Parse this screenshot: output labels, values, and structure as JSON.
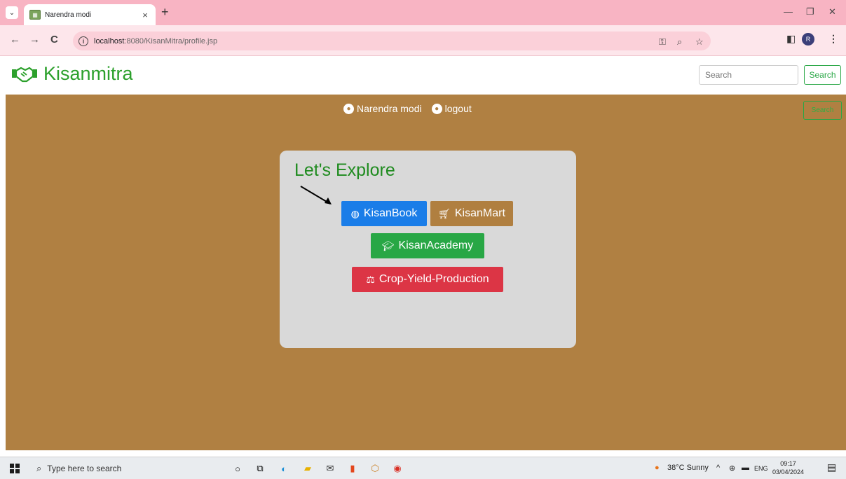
{
  "browser": {
    "tab_title": "Narendra modi",
    "tab_close": "×",
    "new_tab": "+",
    "url_host": "localhost",
    "url_rest": ":8080/KisanMitra/profile.jsp"
  },
  "header": {
    "brand": "Kisanmitra",
    "search_placeholder": "Search",
    "search_button": "Search"
  },
  "userbar": {
    "user_name": "Narendra modi",
    "logout": "logout",
    "ghost_search": "Search"
  },
  "explore": {
    "title": "Let's Explore",
    "buttons": {
      "kisanbook": "KisanBook",
      "kisanmart": "KisanMart",
      "kisanacademy": "KisanAcademy",
      "crop_yield": "Crop-Yield-Production"
    }
  },
  "taskbar": {
    "search_placeholder": "Type here to search",
    "weather": "38°C  Sunny",
    "lang": "ENG",
    "time": "09:17",
    "date": "03/04/2024"
  },
  "colors": {
    "brand_green": "#2ca02c",
    "main_bg": "#b08042",
    "kisanbook_blue": "#1a7de8",
    "academy_green": "#28a745",
    "crop_red": "#dc3545"
  }
}
